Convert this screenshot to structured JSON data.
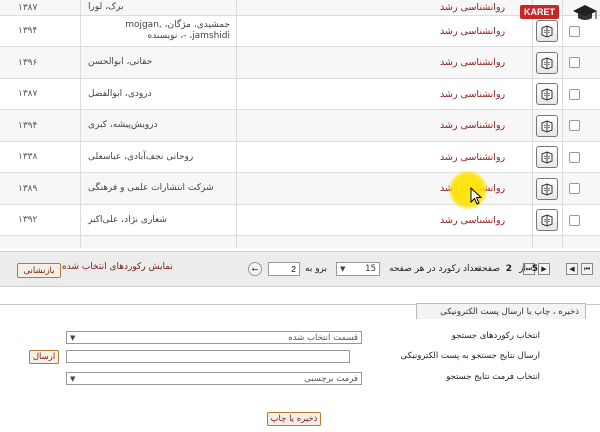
{
  "logo": {
    "text": "KARET"
  },
  "results": {
    "rows": [
      {
        "title": "روانشناسی رشد",
        "author": "برک، لورا",
        "year": "۱۳۸۷"
      },
      {
        "title": "روانشناسی رشد",
        "author": "جمشیدی، مژگان، mojgan, jamshidi، -، نویسنده",
        "year": "۱۳۹۴"
      },
      {
        "title": "روانشناسی رشد",
        "author": "حقانی، ابوالحسن",
        "year": "۱۳۹۶"
      },
      {
        "title": "روانشناسی رشد",
        "author": "درودی، ابوالفضل",
        "year": "۱۳۸۷"
      },
      {
        "title": "روانشناسی رشد",
        "author": "درویش‌پیشه، کبری",
        "year": "۱۳۹۴"
      },
      {
        "title": "روانشناسی رشد",
        "author": "روحانی نجف‌آبادی، عباسعلی",
        "year": "۱۳۳۸"
      },
      {
        "title": "روانشناسی رشد",
        "author": "شرکت انتشارات علمی و فرهنگی",
        "year": "۱۳۸۹"
      },
      {
        "title": "روانشناسی رشد",
        "author": "شعاری نژاد، علی‌اکبر",
        "year": "۱۳۹۲"
      }
    ]
  },
  "pager": {
    "page_label": "صفحه",
    "current_page": "2",
    "of_label": "از",
    "total_pages": "5",
    "per_page_label": "تعداد رکورد در هر صفحه",
    "per_page_value": "15",
    "goto_label": "برو به",
    "goto_value": "2",
    "show_selected_label": "نمایش رکوردهای انتخاب شده",
    "return_label": "بازنشانی",
    "first_btn": "⏮",
    "prev_btn": "◀",
    "next_btn": "▶",
    "last_btn": "⏭",
    "go_btn": "←"
  },
  "panel": {
    "tab_label": "ذخیره ، چاپ یا ارسال پست الکترونیکی",
    "select_records_label": "انتخاب رکوردهای جستجو",
    "select_records_value": "قسمت انتخاب شده",
    "email_label": "ارسال نتایج جستجو به پست الکترونیکی",
    "email_value": "",
    "send_label": "ارسال",
    "format_label": "انتخاب فرمت نتایج جستجو",
    "format_value": "فرمت برچسبی",
    "save_print_label": "ذخیره یا چاپ"
  }
}
